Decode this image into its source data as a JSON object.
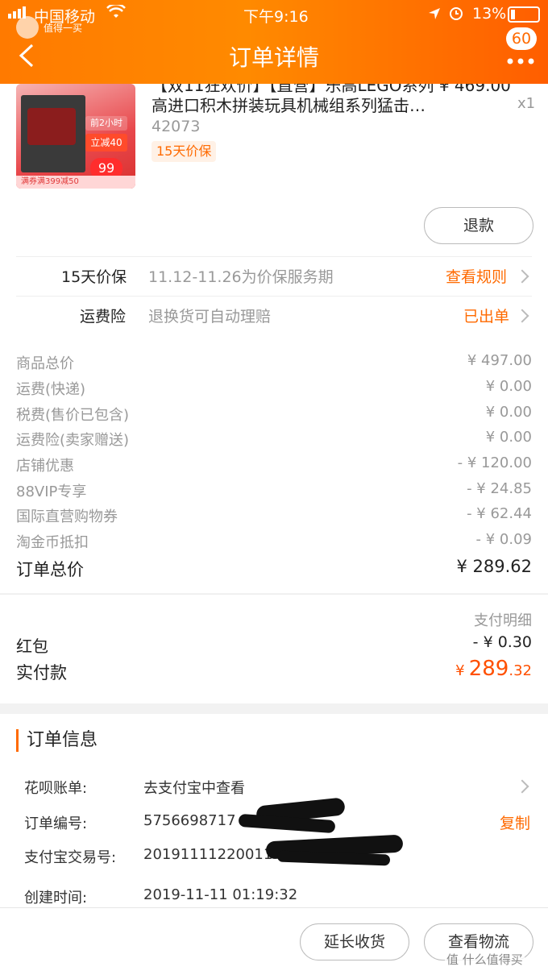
{
  "status_bar": {
    "carrier": "中国移动",
    "time": "下午9:16",
    "battery": "13%"
  },
  "watermark_top": "值得一买",
  "nav": {
    "title": "订单详情",
    "badge": "60"
  },
  "product": {
    "title_line1": "【双11狂欢价】【直营】乐高LEGO系列 ¥ 469.00",
    "title_line2": "高进口积木拼装玩具机械组系列猛击…",
    "qty": "x1",
    "sku": "42073",
    "tag": "15天价保",
    "thumb_promos": [
      "前2小时",
      "立减40",
      "99"
    ],
    "thumb_footer": "满券满399减50"
  },
  "refund_button": "退款",
  "services": [
    {
      "label": "15天价保",
      "desc": "11.12-11.26为价保服务期",
      "link": "查看规则"
    },
    {
      "label": "运费险",
      "desc": "退换货可自动理赔",
      "link": "已出单"
    }
  ],
  "fees": [
    {
      "label": "商品总价",
      "value": "¥ 497.00"
    },
    {
      "label": "运费(快递)",
      "value": "¥ 0.00"
    },
    {
      "label": "税费(售价已包含)",
      "value": "¥ 0.00"
    },
    {
      "label": "运费险(卖家赠送)",
      "value": "¥ 0.00"
    },
    {
      "label": "店铺优惠",
      "value": "- ¥ 120.00"
    },
    {
      "label": "88VIP专享",
      "value": "- ¥ 24.85"
    },
    {
      "label": "国际直营购物券",
      "value": "- ¥ 62.44"
    },
    {
      "label": "淘金币抵扣",
      "value": "- ¥ 0.09"
    }
  ],
  "order_total": {
    "label": "订单总价",
    "value": "¥ 289.62"
  },
  "payment": {
    "detail_link": "支付明细",
    "redpacket_label": "红包",
    "redpacket_value": "- ¥ 0.30",
    "paid_label": "实付款",
    "paid_currency": "¥",
    "paid_int": "289",
    "paid_dec": ".32"
  },
  "order_info": {
    "section_title": "订单信息",
    "huabei_label": "花呗账单:",
    "huabei_value": "去支付宝中查看",
    "order_no_label": "订单编号:",
    "order_no_value": "5756698717",
    "copy_label": "复制",
    "alipay_label": "支付宝交易号:",
    "alipay_value": "20191111220011",
    "created_label": "创建时间:",
    "created_value": "2019-11-11 01:19:32"
  },
  "bottom": {
    "extend_label": "延长收货",
    "logistics_label": "查看物流"
  },
  "watermark_bottom": "值 什么值得买",
  "colors": {
    "accent": "#ff6a00",
    "header_start": "#ff7a00",
    "header_end": "#ff5e00"
  }
}
